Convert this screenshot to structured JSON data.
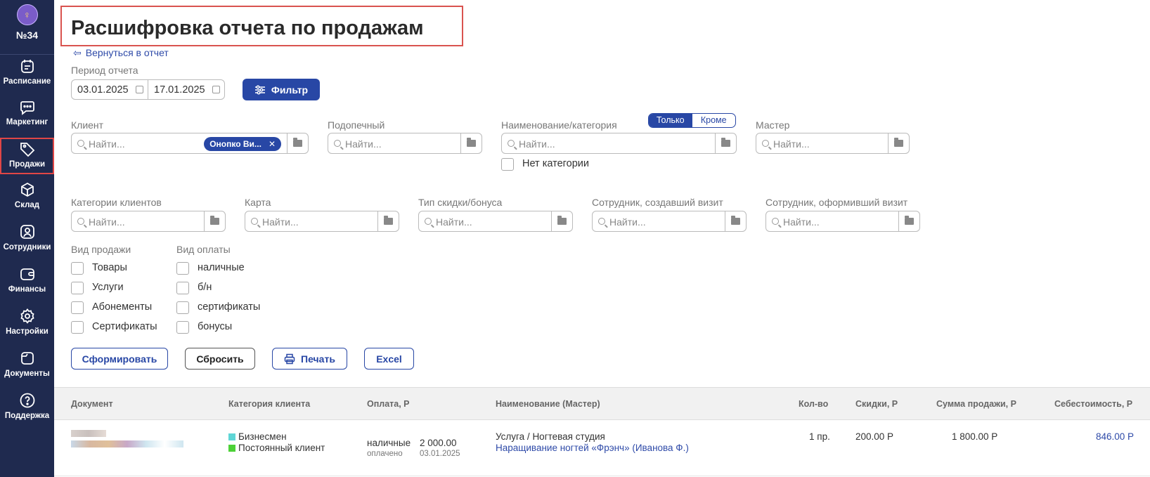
{
  "sidebar": {
    "branch": "№34",
    "items": [
      {
        "label": "Расписание",
        "icon": "calendar-icon"
      },
      {
        "label": "Маркетинг",
        "icon": "chat-icon"
      },
      {
        "label": "Продажи",
        "icon": "tag-icon",
        "active": true
      },
      {
        "label": "Склад",
        "icon": "box-icon"
      },
      {
        "label": "Сотрудники",
        "icon": "user-icon"
      },
      {
        "label": "Финансы",
        "icon": "wallet-icon"
      },
      {
        "label": "Настройки",
        "icon": "gear-icon"
      },
      {
        "label": "Документы",
        "icon": "document-icon"
      },
      {
        "label": "Поддержка",
        "icon": "help-icon"
      }
    ]
  },
  "page": {
    "title": "Расшифровка отчета по продажам",
    "back_link": "Вернуться в отчет"
  },
  "period": {
    "label": "Период отчета",
    "from": "03.01.2025",
    "to": "17.01.2025",
    "filter_button": "Фильтр"
  },
  "filters": {
    "client": {
      "label": "Клиент",
      "placeholder": "Найти...",
      "chip": "Онопко Ви..."
    },
    "ward": {
      "label": "Подопечный",
      "placeholder": "Найти..."
    },
    "name_category": {
      "label": "Наименование/категория",
      "placeholder": "Найти...",
      "toggle_on": "Только",
      "toggle_off": "Кроме",
      "no_category": "Нет категории"
    },
    "master": {
      "label": "Мастер",
      "placeholder": "Найти..."
    },
    "client_categories": {
      "label": "Категории клиентов",
      "placeholder": "Найти..."
    },
    "card": {
      "label": "Карта",
      "placeholder": "Найти..."
    },
    "discount_type": {
      "label": "Тип скидки/бонуса",
      "placeholder": "Найти..."
    },
    "creator": {
      "label": "Сотрудник, создавший визит",
      "placeholder": "Найти..."
    },
    "processor": {
      "label": "Сотрудник, оформивший визит",
      "placeholder": "Найти..."
    }
  },
  "sale_type": {
    "label": "Вид продажи",
    "options": [
      "Товары",
      "Услуги",
      "Абонементы",
      "Сертификаты"
    ]
  },
  "payment_type": {
    "label": "Вид оплаты",
    "options": [
      "наличные",
      "б/н",
      "сертификаты",
      "бонусы"
    ]
  },
  "actions": {
    "generate": "Сформировать",
    "reset": "Сбросить",
    "print": "Печать",
    "excel": "Excel"
  },
  "table": {
    "headers": [
      "Документ",
      "Категория клиента",
      "Оплата, Р",
      "Наименование (Мастер)",
      "Кол-во",
      "Скидки, Р",
      "Сумма продажи, Р",
      "Себестоимость, Р"
    ],
    "rows": [
      {
        "categories": [
          {
            "name": "Бизнесмен",
            "color": "#5fd6d6"
          },
          {
            "name": "Постоянный клиент",
            "color": "#4cd137"
          }
        ],
        "payment_method": "наличные",
        "payment_status": "оплачено",
        "payment_amount": "2 000.00",
        "payment_date": "03.01.2025",
        "item_type": "Услуга / Ногтевая студия",
        "item_name": "Наращивание ногтей «Фрэнч» (Иванова Ф.)",
        "qty": "1 пр.",
        "discount": "200.00 Р",
        "sum": "1 800.00 Р",
        "cost": "846.00 Р"
      }
    ]
  },
  "colors": {
    "sidebar": "#1f2a4f",
    "accent": "#2847a5",
    "highlight": "#d9534f"
  }
}
